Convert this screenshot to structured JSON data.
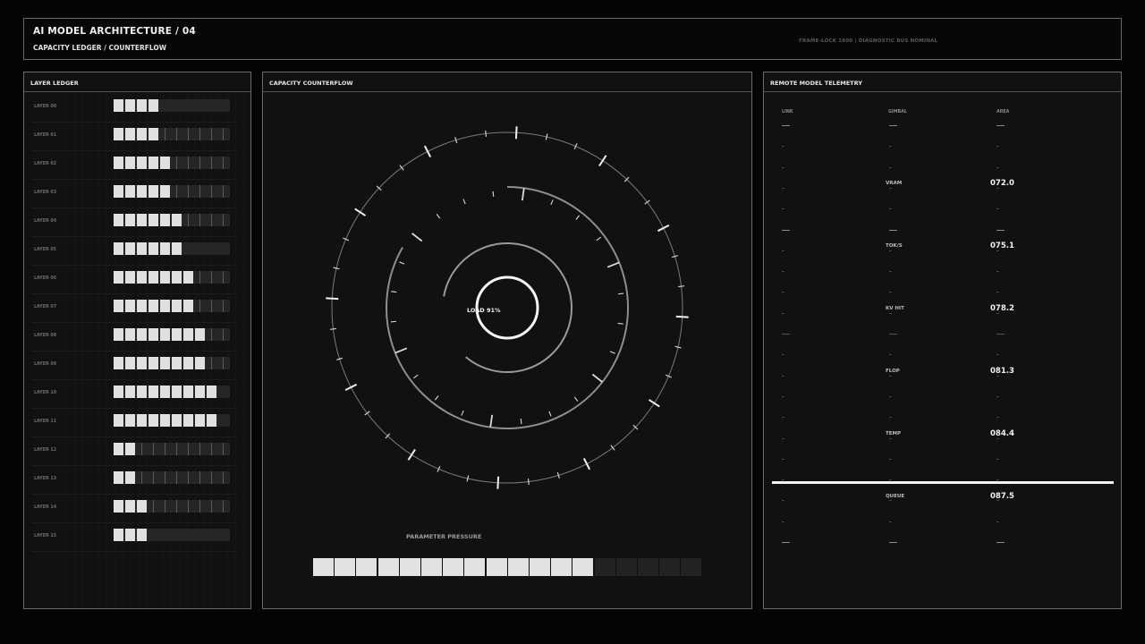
{
  "header": {
    "title": "AI MODEL ARCHITECTURE / 04",
    "subtitle": "CAPACITY LEDGER / COUNTERFLOW",
    "status": "FRAME-LOCK 1800 | DIAGNOSTIC BUS NOMINAL"
  },
  "ledger": {
    "title": "LAYER LEDGER",
    "segments_total": 10,
    "rows": [
      {
        "label": "LAYER 00",
        "filled": 4,
        "ticks": false
      },
      {
        "label": "LAYER 01",
        "filled": 4,
        "ticks": true
      },
      {
        "label": "LAYER 02",
        "filled": 5,
        "ticks": true
      },
      {
        "label": "LAYER 03",
        "filled": 5,
        "ticks": true
      },
      {
        "label": "LAYER 04",
        "filled": 6,
        "ticks": true
      },
      {
        "label": "LAYER 05",
        "filled": 6,
        "ticks": false
      },
      {
        "label": "LAYER 06",
        "filled": 7,
        "ticks": true
      },
      {
        "label": "LAYER 07",
        "filled": 7,
        "ticks": true
      },
      {
        "label": "LAYER 08",
        "filled": 8,
        "ticks": true
      },
      {
        "label": "LAYER 09",
        "filled": 8,
        "ticks": true
      },
      {
        "label": "LAYER 10",
        "filled": 9,
        "ticks": false
      },
      {
        "label": "LAYER 11",
        "filled": 9,
        "ticks": false
      },
      {
        "label": "LAYER 12",
        "filled": 2,
        "ticks": true
      },
      {
        "label": "LAYER 13",
        "filled": 2,
        "ticks": true
      },
      {
        "label": "LAYER 14",
        "filled": 3,
        "ticks": true
      },
      {
        "label": "LAYER 15",
        "filled": 3,
        "ticks": false
      }
    ]
  },
  "counterflow": {
    "title": "CAPACITY COUNTERFLOW",
    "load_label": "LOAD 91%",
    "pressure_label": "PARAMETER PRESSURE",
    "pressure_total": 18,
    "pressure_filled": 13
  },
  "telemetry": {
    "title": "REMOTE MODEL TELEMETRY",
    "columns": [
      "LINK",
      "GIMBAL",
      "AREA"
    ],
    "metrics": [
      {
        "label": "VRAM",
        "value": "072.0"
      },
      {
        "label": "TOK/S",
        "value": "075.1"
      },
      {
        "label": "KV HIT",
        "value": "078.2"
      },
      {
        "label": "FLOP",
        "value": "081.3"
      },
      {
        "label": "TEMP",
        "value": "084.4"
      },
      {
        "label": "QUEUE",
        "value": "087.5"
      }
    ]
  },
  "colors": {
    "background": "#050505",
    "panel": "#101110",
    "accent": "#f2f2f2",
    "dim": "#2e2e2e"
  }
}
